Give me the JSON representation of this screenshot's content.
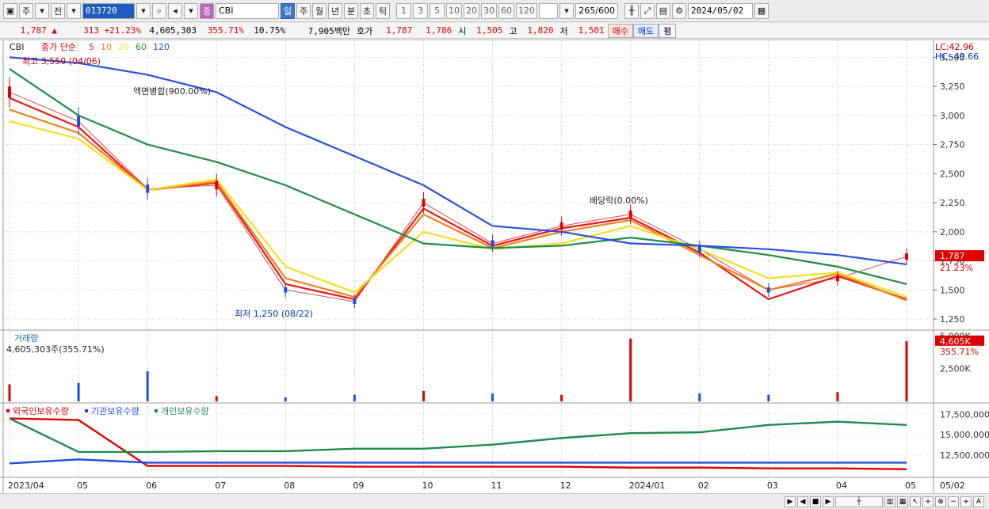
{
  "toolbar": {
    "mode_a": "주",
    "mode_b": "전",
    "stock_code": "013720",
    "stock_name": "CBI",
    "periods": [
      "일",
      "주",
      "월",
      "년",
      "분",
      "초",
      "틱"
    ],
    "active_period": "일",
    "intervals": [
      "1",
      "3",
      "5",
      "10",
      "20",
      "30",
      "60",
      "120"
    ],
    "count_display": "265/600",
    "date": "2024/05/02"
  },
  "quote": {
    "price": "1,787 ▲",
    "change": "313 +21.23%",
    "volume": "4,605,303",
    "volume_ratio": "355.71%",
    "turnover": "10.75%",
    "amount": "7,905백만",
    "bid_label": "호가",
    "ask": "1,787",
    "bid": "1,786",
    "open_label": "시",
    "open": "1,505",
    "high_label": "고",
    "high": "1,820",
    "low_label": "저",
    "low": "1,501",
    "buy_label": "매수",
    "sell_label": "매도",
    "eval_label": "평"
  },
  "price_panel": {
    "name": "CBI",
    "legend_prefix": "종가 단순",
    "ma_periods": [
      "5",
      "10",
      "20",
      "60",
      "120"
    ],
    "ma_colors": [
      "#e81818",
      "#f08020",
      "#f0e020",
      "#208c40",
      "#2850e0"
    ],
    "high_note": "최고 3,550 (04/06)",
    "low_note": "최저 1,250 (08/22)",
    "event_split": "액면병합(900.00%)",
    "event_dividend": "배당락(0.00%)",
    "lc": "LC:42.96",
    "hc": "HC:-49.66",
    "current_price_tag": "1,787",
    "current_change_tag": "21.23%",
    "y_ticks": [
      "3,500",
      "3,250",
      "3,000",
      "2,750",
      "2,500",
      "2,250",
      "2,000",
      "1,750",
      "1,500",
      "1,250"
    ]
  },
  "volume_panel": {
    "title": "거래량",
    "value": "4,605,303주(355.71%)",
    "tag_value": "4,605K",
    "tag_ratio": "355.71%",
    "y_ticks": [
      "5,000K",
      "2,500K"
    ]
  },
  "holding_panel": {
    "series": [
      {
        "name": "외국인보유수량",
        "color": "#e00000"
      },
      {
        "name": "기관보유수량",
        "color": "#1e4ee0"
      },
      {
        "name": "개인보유수량",
        "color": "#1f8a4c"
      }
    ],
    "y_ticks": [
      "17,500,000",
      "15,000,000",
      "12,500,000"
    ]
  },
  "x_axis": {
    "labels": [
      "2023/04",
      "05",
      "06",
      "07",
      "08",
      "09",
      "10",
      "11",
      "12",
      "2024/01",
      "02",
      "03",
      "04",
      "05",
      "05/02"
    ]
  },
  "chart_data": {
    "type": "line",
    "title": "",
    "x": [
      "2023/04",
      "05",
      "06",
      "07",
      "08",
      "09",
      "10",
      "11",
      "12",
      "2024/01",
      "02",
      "03",
      "04",
      "05"
    ],
    "series": [
      {
        "name": "",
        "values": [
          3200,
          2950,
          2370,
          2400,
          1500,
          1400,
          2250,
          1900,
          2050,
          2150,
          1850,
          1500,
          1600,
          1787
        ]
      },
      {
        "name": "5",
        "values": [
          3150,
          2900,
          2360,
          2420,
          1550,
          1420,
          2200,
          1880,
          2030,
          2120,
          1820,
          1420,
          1620,
          1420
        ]
      },
      {
        "name": "10",
        "values": [
          3050,
          2850,
          2360,
          2430,
          1600,
          1440,
          2150,
          1860,
          2000,
          2100,
          1800,
          1500,
          1640,
          1410
        ]
      },
      {
        "name": "20",
        "values": [
          2950,
          2800,
          2360,
          2450,
          1700,
          1480,
          2000,
          1850,
          1900,
          2050,
          1850,
          1600,
          1650,
          1440
        ]
      },
      {
        "name": "60",
        "values": [
          3400,
          3000,
          2750,
          2600,
          2400,
          2150,
          1900,
          1860,
          1880,
          1950,
          1880,
          1800,
          1700,
          1550
        ]
      },
      {
        "name": "120",
        "values": [
          3500,
          3450,
          3350,
          3200,
          2900,
          2650,
          2400,
          2050,
          2000,
          1900,
          1880,
          1850,
          1800,
          1720
        ]
      }
    ],
    "volume_values": [
      1300,
      1400,
      2300,
      400,
      300,
      500,
      800,
      600,
      500,
      4800,
      600,
      500,
      700,
      4605
    ],
    "holding": {
      "foreign": [
        17000000,
        16800000,
        11200000,
        11200000,
        11200000,
        11100000,
        11100000,
        11100000,
        11100000,
        11000000,
        11000000,
        10900000,
        10900000,
        10800000
      ],
      "institution": [
        11500000,
        12000000,
        11600000,
        11600000,
        11600000,
        11600000,
        11600000,
        11600000,
        11600000,
        11600000,
        11600000,
        11600000,
        11600000,
        11600000
      ],
      "individual": [
        17000000,
        12900000,
        12900000,
        13000000,
        13000000,
        13300000,
        13300000,
        13800000,
        14600000,
        15200000,
        15300000,
        16200000,
        16600000,
        16200000
      ]
    },
    "ylim": [
      1250,
      3550
    ]
  }
}
